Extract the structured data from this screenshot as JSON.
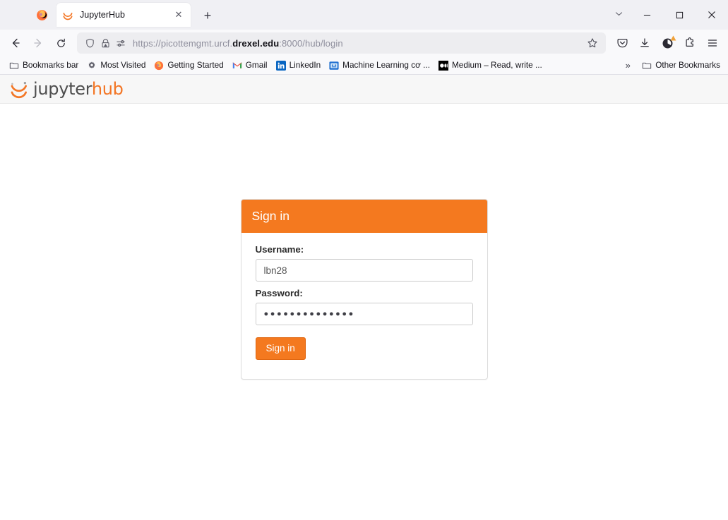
{
  "browser": {
    "tab": {
      "title": "JupyterHub",
      "favicon": "jupyter-circle-icon",
      "close_label": "✕"
    },
    "newtab_label": "+",
    "window_controls": {
      "tab_list": "⌄",
      "minimize": "—",
      "maximize": "□",
      "close": "✕"
    },
    "nav": {
      "back": "←",
      "forward": "→",
      "reload": "↻"
    },
    "urlbar": {
      "url_prefix": "https://picottemgmt.urcf.",
      "url_domain": "drexel.edu",
      "url_suffix": ":8000/hub/login",
      "full_url": "https://picottemgmt.urcf.drexel.edu:8000/hub/login",
      "shield_icon": "shield-icon",
      "lock_icon": "lock-warning-icon",
      "permissions_icon": "permissions-icon",
      "bookmark_star": "☆"
    },
    "toolbar_right": [
      {
        "name": "pocket-icon",
        "label": "Save to Pocket"
      },
      {
        "name": "downloads-icon",
        "label": "Downloads"
      },
      {
        "name": "account-icon",
        "label": "Account"
      },
      {
        "name": "extensions-icon",
        "label": "Extensions"
      },
      {
        "name": "app-menu-icon",
        "label": "Open application menu"
      }
    ],
    "bookmarks": [
      {
        "label": "Bookmarks bar",
        "icon": "folder-icon"
      },
      {
        "label": "Most Visited",
        "icon": "gear-icon"
      },
      {
        "label": "Getting Started",
        "icon": "firefox-icon"
      },
      {
        "label": "Gmail",
        "icon": "gmail-icon"
      },
      {
        "label": "LinkedIn",
        "icon": "linkedin-icon"
      },
      {
        "label": "Machine Learning cơ ...",
        "icon": "generic-site-icon"
      },
      {
        "label": "Medium – Read, write ...",
        "icon": "medium-icon"
      }
    ],
    "bookmarks_overflow": "»",
    "other_bookmarks": {
      "label": "Other Bookmarks",
      "icon": "folder-icon"
    }
  },
  "page": {
    "brand": {
      "word_first": "jupyter",
      "word_second": "hub",
      "logo": "jupyter-logo-icon"
    },
    "login": {
      "header_title": "Sign in",
      "username_label": "Username:",
      "username_value": "lbn28",
      "username_placeholder": "",
      "password_label": "Password:",
      "password_value": "●●●●●●●●●●●●●●",
      "password_placeholder": "",
      "submit_label": "Sign in"
    }
  },
  "colors": {
    "accent_orange": "#f4791f",
    "brand_gray": "#4e4e4e",
    "card_border": "#dddddd",
    "navbar_bg": "#f7f7f7"
  }
}
